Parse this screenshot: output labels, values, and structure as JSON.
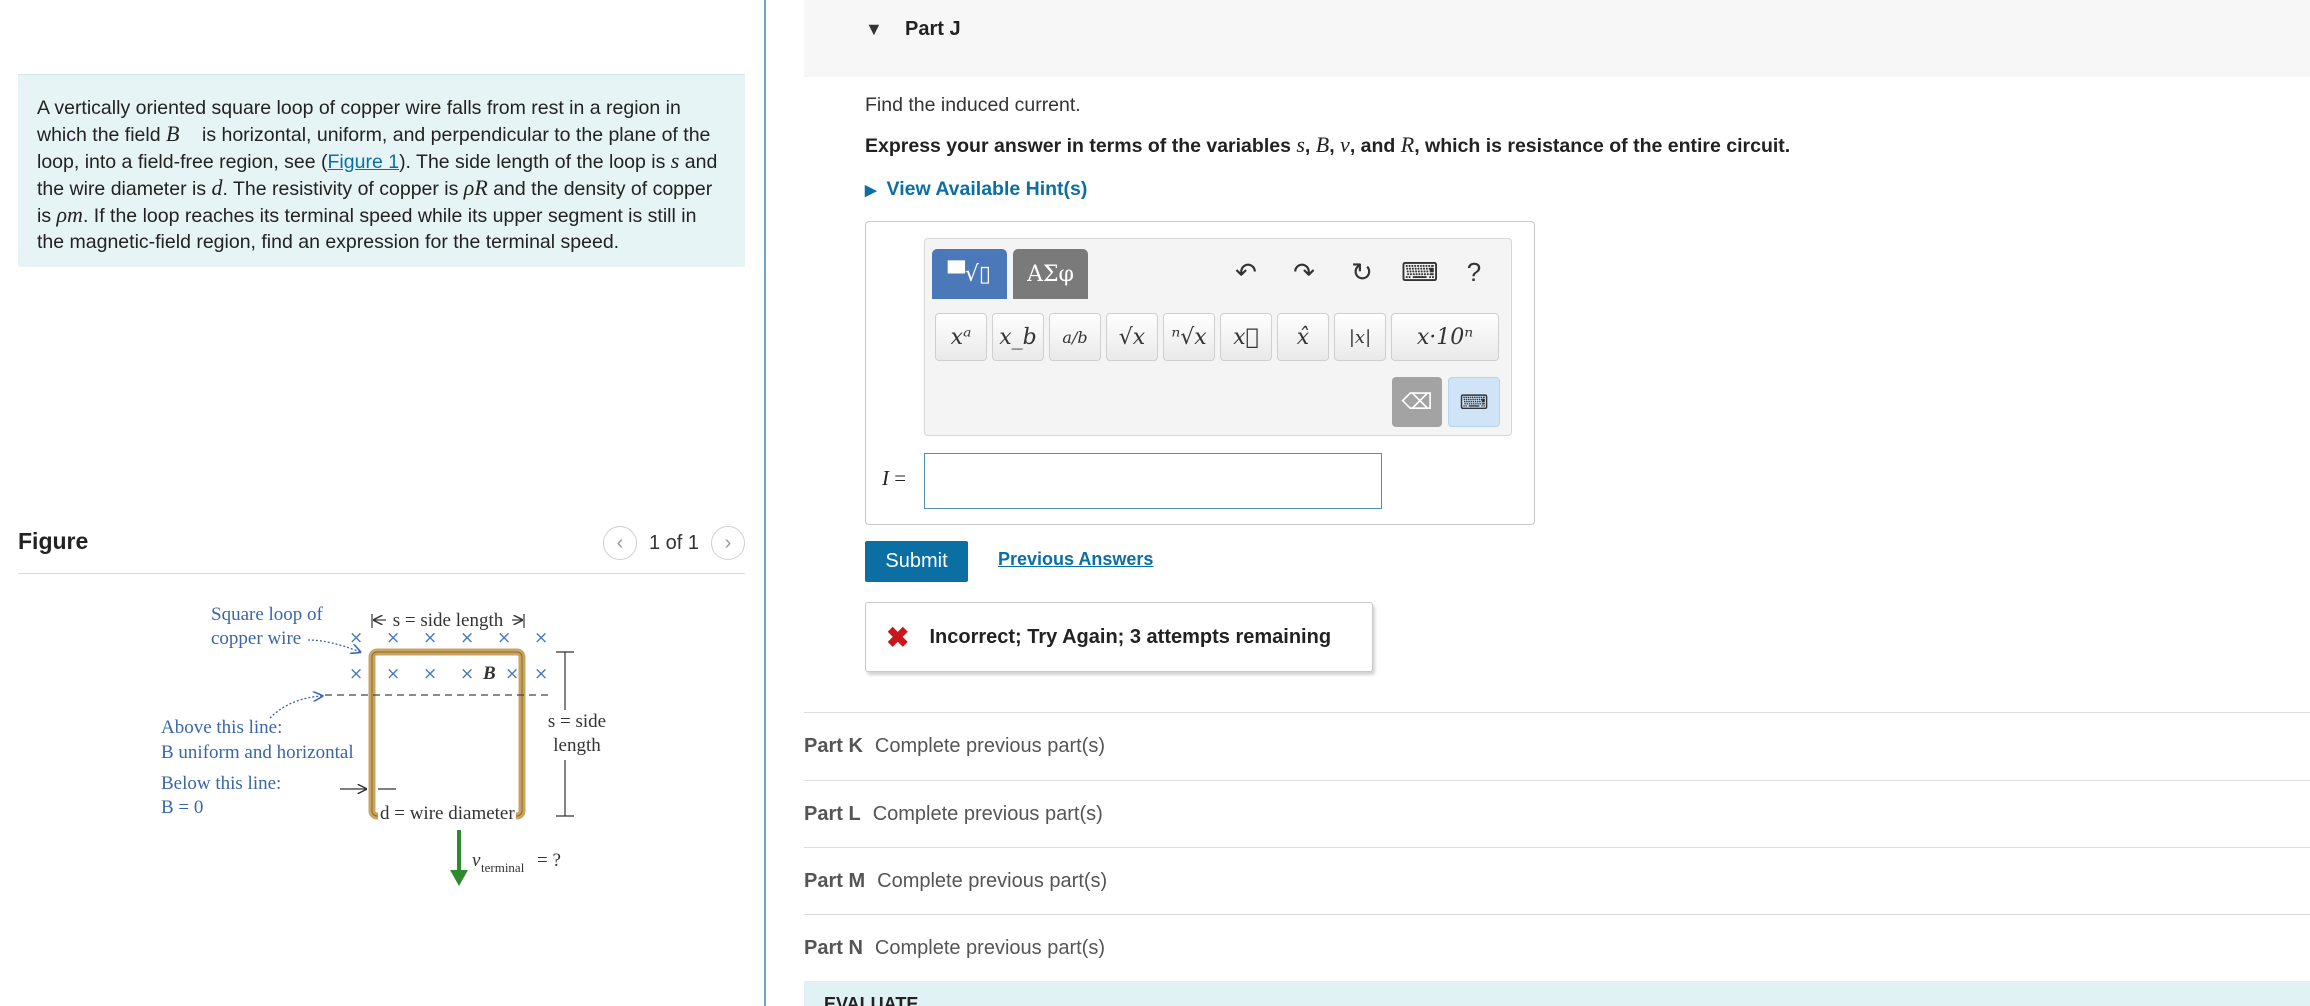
{
  "problem": {
    "seg1": "A vertically oriented square loop of copper wire falls from rest in a region in which the field ",
    "B": "B⃗",
    "seg2": " is horizontal, uniform, and perpendicular to the plane of the loop, into a field-free region, see (",
    "figure_link": "Figure 1",
    "seg3": "). The side length of the loop is ",
    "s": "s",
    "seg4": " and the wire diameter is ",
    "d": "d",
    "seg5": ". The resistivity of copper is ",
    "rhoR": "ρR",
    "seg6": " and the density of copper is ",
    "rhom": "ρm",
    "seg7": ". If the loop reaches its terminal speed while its upper segment is still in the magnetic-field region, find an expression for the terminal speed."
  },
  "figure": {
    "title": "Figure",
    "pager": "1 of 1",
    "prev_icon": "chevron-left-icon",
    "next_icon": "chevron-right-icon",
    "label_loop1": "Square loop of",
    "label_loop2": "copper wire",
    "label_side_top": "s = side length",
    "label_B_inside": "B",
    "label_side_right1": "s = side",
    "label_side_right2": "length",
    "label_above1": "Above this line:",
    "label_above2": "B uniform and horizontal",
    "label_below1": "Below this line:",
    "label_below2": "B = 0",
    "label_wire": "d = wire diameter",
    "label_vterm": "v",
    "label_vterm_sub": "terminal",
    "label_vterm_eq": "= ?",
    "colors": {
      "label_blue": "#3a66a8",
      "loop_gold": "#c9a461",
      "arrow_green": "#2f8a2f"
    }
  },
  "part_j": {
    "title": "Part J",
    "caret_icon": "caret-down-icon",
    "prompt": "Find the induced current.",
    "instruction_a": "Express your answer in terms of the variables ",
    "var_s": "s",
    "sep1": ", ",
    "var_B": "B",
    "sep2": ", ",
    "var_v": "v",
    "sep3": ", and ",
    "var_R": "R",
    "instruction_b": ", which is resistance of the entire circuit.",
    "hints": "View Available Hint(s)",
    "variable": "I",
    "equals": " =",
    "answer_value": "",
    "submit": "Submit",
    "previous_answers": "Previous Answers",
    "feedback": "Incorrect; Try Again; 3 attempts remaining"
  },
  "toolbar": {
    "tab1": "▀√▯",
    "tab2": "ΑΣφ",
    "undo": "↶",
    "redo": "↷",
    "reset": "↻",
    "keyboard": "⌨",
    "help": "?",
    "btn_pow": "xᵃ",
    "btn_sub": "x_b",
    "btn_frac": "a/b",
    "btn_sqrt": "√x",
    "btn_nroot": "ⁿ√x",
    "btn_vec": "x⃗",
    "btn_hat": "x̂",
    "btn_abs": "|x|",
    "btn_sci": "x·10ⁿ",
    "backspace": "⌫",
    "kbd_toggle": "⌨"
  },
  "parts": [
    {
      "label": "Part K",
      "status": "Complete previous part(s)"
    },
    {
      "label": "Part L",
      "status": "Complete previous part(s)"
    },
    {
      "label": "Part M",
      "status": "Complete previous part(s)"
    },
    {
      "label": "Part N",
      "status": "Complete previous part(s)"
    }
  ],
  "evaluate": "EVALUATE"
}
